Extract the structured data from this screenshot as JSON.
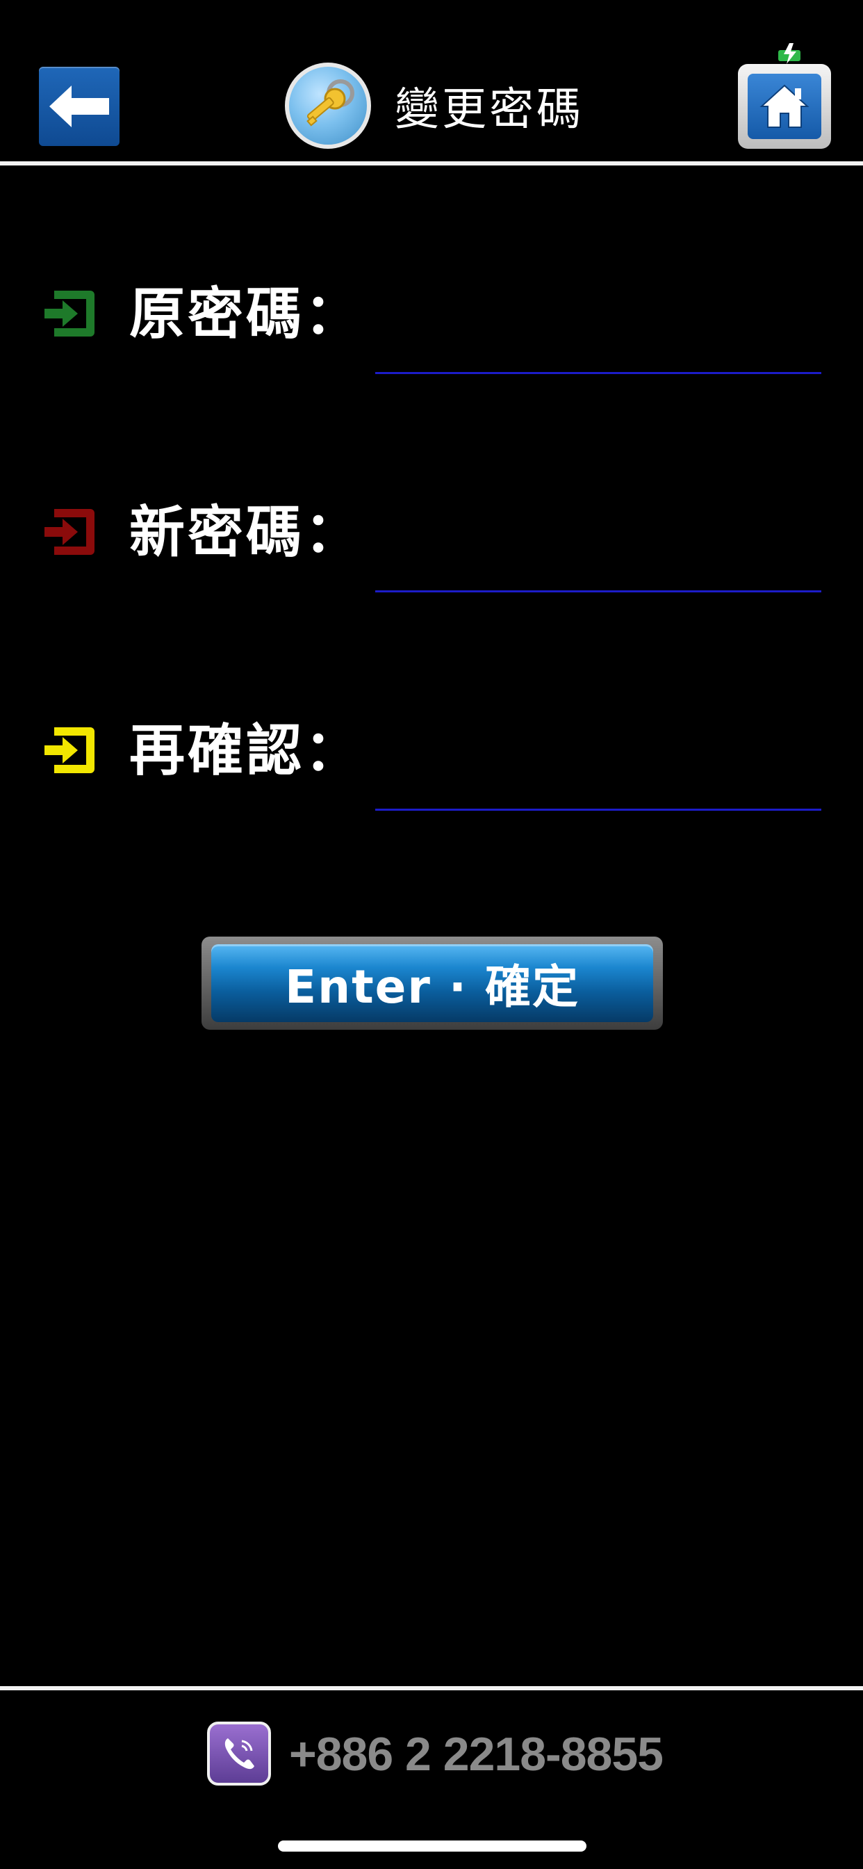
{
  "header": {
    "title": "變更密碼",
    "back_icon": "arrow-left-icon",
    "title_icon": "key-icon",
    "home_icon": "home-icon"
  },
  "form": {
    "fields": [
      {
        "label": "原密碼：",
        "icon": "login-arrow-icon",
        "icon_color": "#1e7a2a",
        "value": "",
        "placeholder": ""
      },
      {
        "label": "新密碼：",
        "icon": "login-arrow-icon",
        "icon_color": "#8b0b0b",
        "value": "",
        "placeholder": ""
      },
      {
        "label": "再確認：",
        "icon": "login-arrow-icon",
        "icon_color": "#f2e600",
        "value": "",
        "placeholder": ""
      }
    ],
    "underline_color": "#1c1cc8"
  },
  "enter_button": {
    "label": "Enter · 確定"
  },
  "footer": {
    "phone": "+886 2 2218-8855",
    "phone_icon": "viber-phone-icon"
  },
  "colors": {
    "background": "#000000",
    "divider": "#f2f2f2",
    "button_blue": "#1b86cf",
    "phone_text": "#8a8a8a"
  }
}
